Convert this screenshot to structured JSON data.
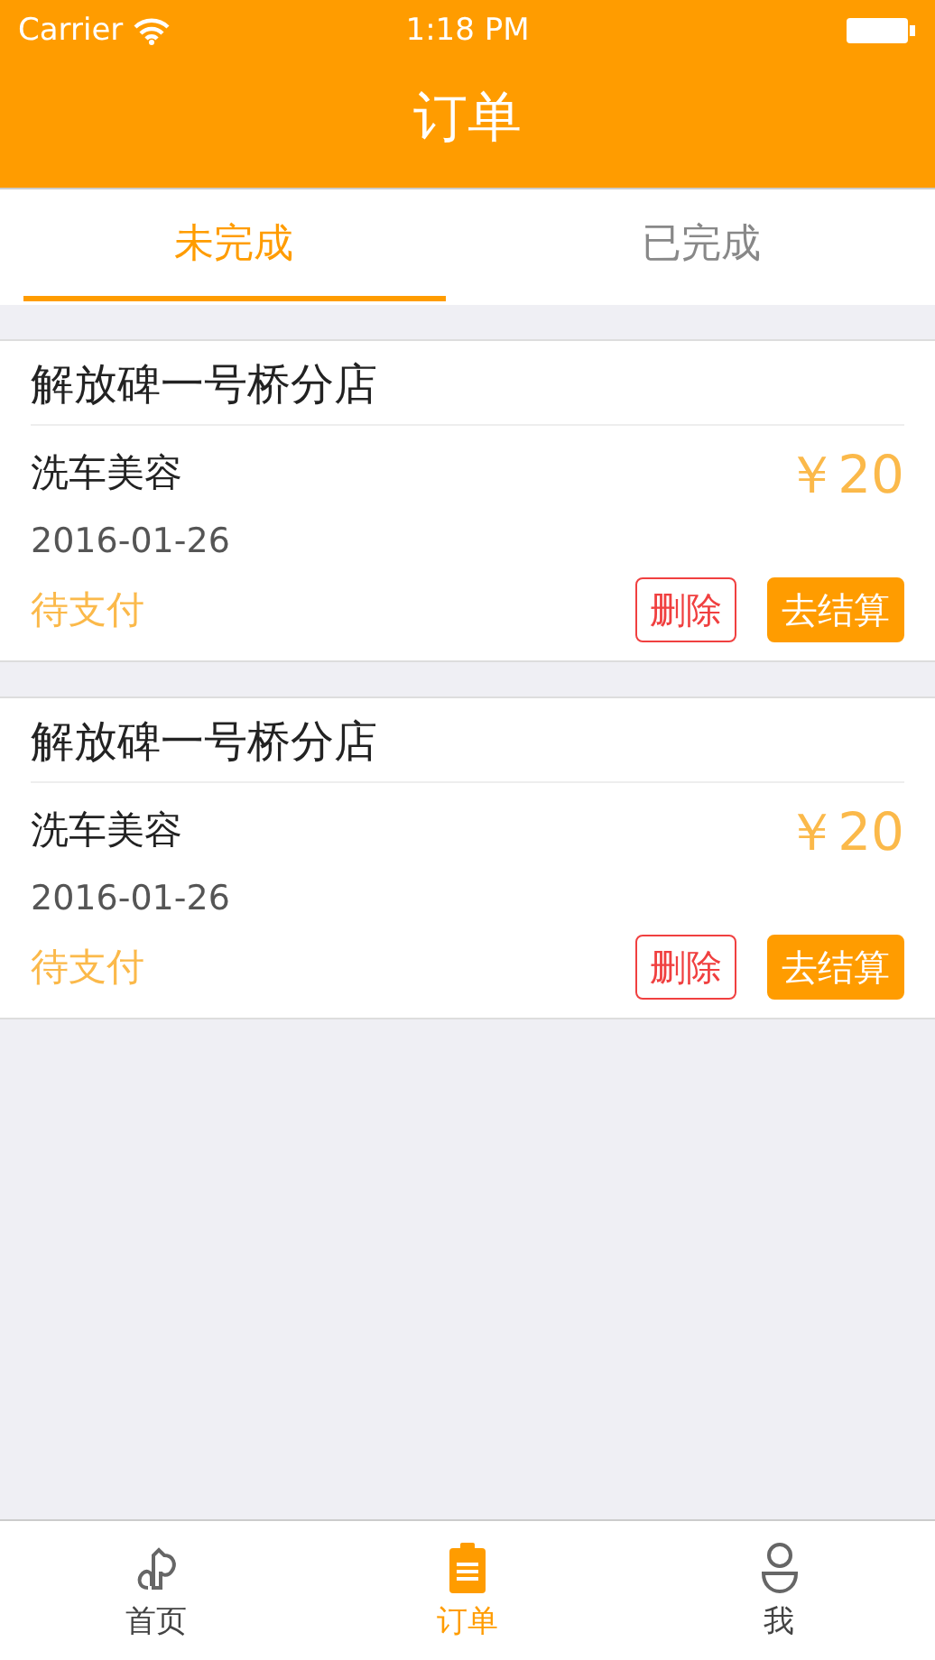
{
  "status_bar": {
    "carrier": "Carrier",
    "time": "1:18 PM"
  },
  "nav": {
    "title": "订单"
  },
  "tabs": [
    {
      "label": "未完成",
      "selected": true
    },
    {
      "label": "已完成",
      "selected": false
    }
  ],
  "orders": [
    {
      "store": "解放碑一号桥分店",
      "service": "洗车美容",
      "date": "2016-01-26",
      "status": "待支付",
      "price": "￥20",
      "actions": [
        "删除",
        "去结算"
      ]
    },
    {
      "store": "解放碑一号桥分店",
      "service": "洗车美容",
      "date": "2016-01-26",
      "status": "待支付",
      "price": "￥20",
      "actions": [
        "删除",
        "去结算"
      ]
    }
  ],
  "tab_bar": [
    {
      "kind": "home",
      "label": "首页",
      "selected": false
    },
    {
      "kind": "orders",
      "label": "订单",
      "selected": true
    },
    {
      "kind": "me",
      "label": "我",
      "selected": false
    }
  ]
}
